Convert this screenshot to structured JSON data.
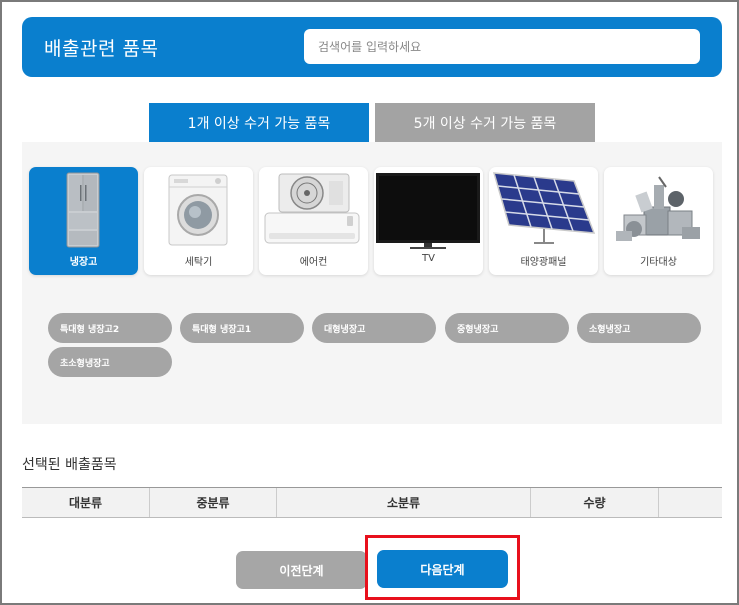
{
  "header": {
    "title": "배출관련 품목",
    "search_placeholder": "검색어를 입력하세요"
  },
  "tabs": [
    {
      "label": "1개 이상 수거 가능 품목",
      "active": true
    },
    {
      "label": "5개 이상 수거 가능 품목",
      "active": false
    }
  ],
  "categories": [
    {
      "label": "냉장고",
      "icon": "refrigerator-icon",
      "active": true
    },
    {
      "label": "세탁기",
      "icon": "washing-machine-icon",
      "active": false
    },
    {
      "label": "에어컨",
      "icon": "air-conditioner-icon",
      "active": false
    },
    {
      "label": "TV",
      "icon": "tv-icon",
      "active": false
    },
    {
      "label": "태양광패널",
      "icon": "solar-panel-icon",
      "active": false
    },
    {
      "label": "기타대상",
      "icon": "misc-appliances-icon",
      "active": false
    }
  ],
  "subcategories": [
    "특대형 냉장고2",
    "특대형 냉장고1",
    "대형냉장고",
    "중형냉장고",
    "소형냉장고",
    "초소형냉장고"
  ],
  "selected": {
    "title": "선택된 배출품목",
    "columns": [
      "대분류",
      "중분류",
      "소분류",
      "수량",
      ""
    ]
  },
  "buttons": {
    "prev": "이전단계",
    "next": "다음단계"
  },
  "colors": {
    "accent": "#0a7fce",
    "inactive": "#a5a5a5",
    "highlight": "#e8101c"
  }
}
